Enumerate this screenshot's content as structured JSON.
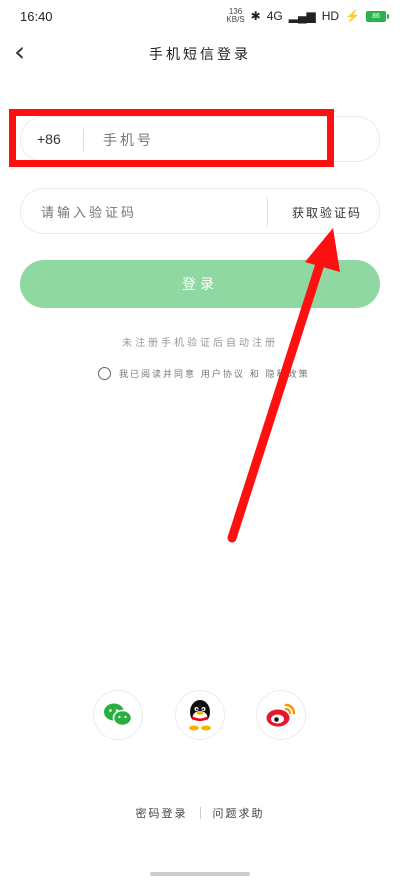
{
  "status_bar": {
    "time": "16:40",
    "net_speed_value": "136",
    "net_speed_unit": "KB/S",
    "signal": "4G",
    "hd": "HD",
    "battery": "86"
  },
  "header": {
    "title": "手机短信登录"
  },
  "phone": {
    "country_code": "+86",
    "placeholder": "手机号"
  },
  "code": {
    "placeholder": "请输入验证码",
    "get_code_label": "获取验证码"
  },
  "login": {
    "label": "登录"
  },
  "note": "未注册手机验证后自动注册",
  "agreement": {
    "text": "我已阅读并同意 用户协议 和 隐私政策",
    "checked": false
  },
  "social": {
    "icons": [
      "wechat-icon",
      "qq-icon",
      "weibo-icon"
    ]
  },
  "footer": {
    "password_login": "密码登录",
    "help": "问题求助"
  },
  "colors": {
    "accent": "#8fd8a2",
    "annotation": "#ff1010",
    "wechat": "#2aae3f",
    "weibo": "#e6162d"
  }
}
